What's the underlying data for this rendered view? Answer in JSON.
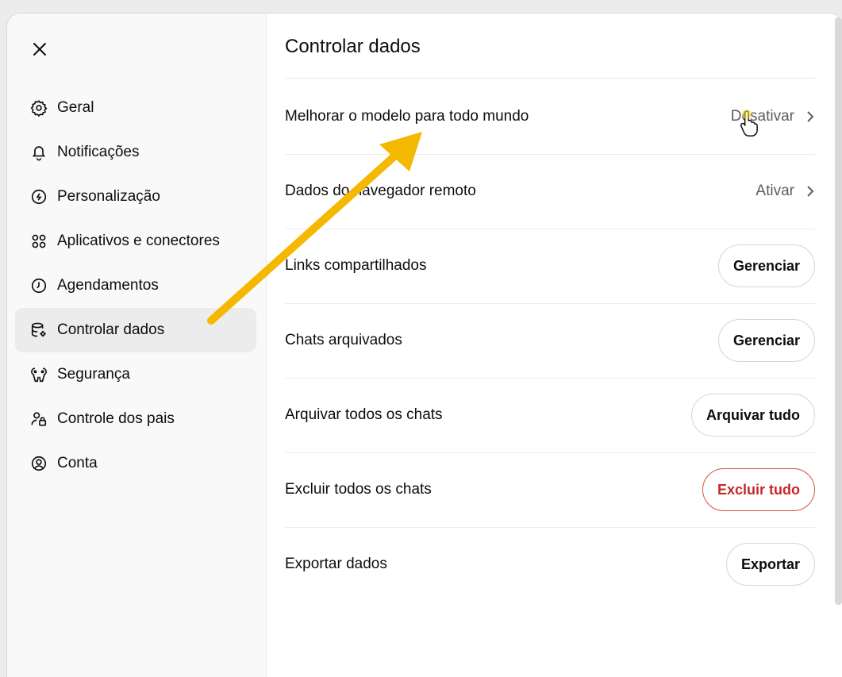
{
  "sidebar": {
    "close_icon": "close-icon",
    "items": [
      {
        "label": "Geral",
        "icon": "gear-icon"
      },
      {
        "label": "Notificações",
        "icon": "bell-icon"
      },
      {
        "label": "Personalização",
        "icon": "personalization-icon"
      },
      {
        "label": "Aplicativos e conectores",
        "icon": "apps-icon"
      },
      {
        "label": "Agendamentos",
        "icon": "clock-icon"
      },
      {
        "label": "Controlar dados",
        "icon": "database-gear-icon",
        "active": true
      },
      {
        "label": "Segurança",
        "icon": "shield-key-icon"
      },
      {
        "label": "Controle dos pais",
        "icon": "parental-control-icon"
      },
      {
        "label": "Conta",
        "icon": "account-icon"
      }
    ]
  },
  "main": {
    "title": "Controlar dados",
    "rows": [
      {
        "label": "Melhorar o modelo para todo mundo",
        "value": "Desativar"
      },
      {
        "label": "Dados do navegador remoto",
        "value": "Ativar"
      },
      {
        "label": "Links compartilhados",
        "button": "Gerenciar"
      },
      {
        "label": "Chats arquivados",
        "button": "Gerenciar"
      },
      {
        "label": "Arquivar todos os chats",
        "button": "Arquivar tudo"
      },
      {
        "label": "Excluir todos os chats",
        "button": "Excluir tudo"
      },
      {
        "label": "Exportar dados",
        "button": "Exportar"
      }
    ]
  },
  "colors": {
    "annotation_arrow": "#f5b800",
    "danger": "#c62828",
    "active_nav": "#ececec"
  }
}
